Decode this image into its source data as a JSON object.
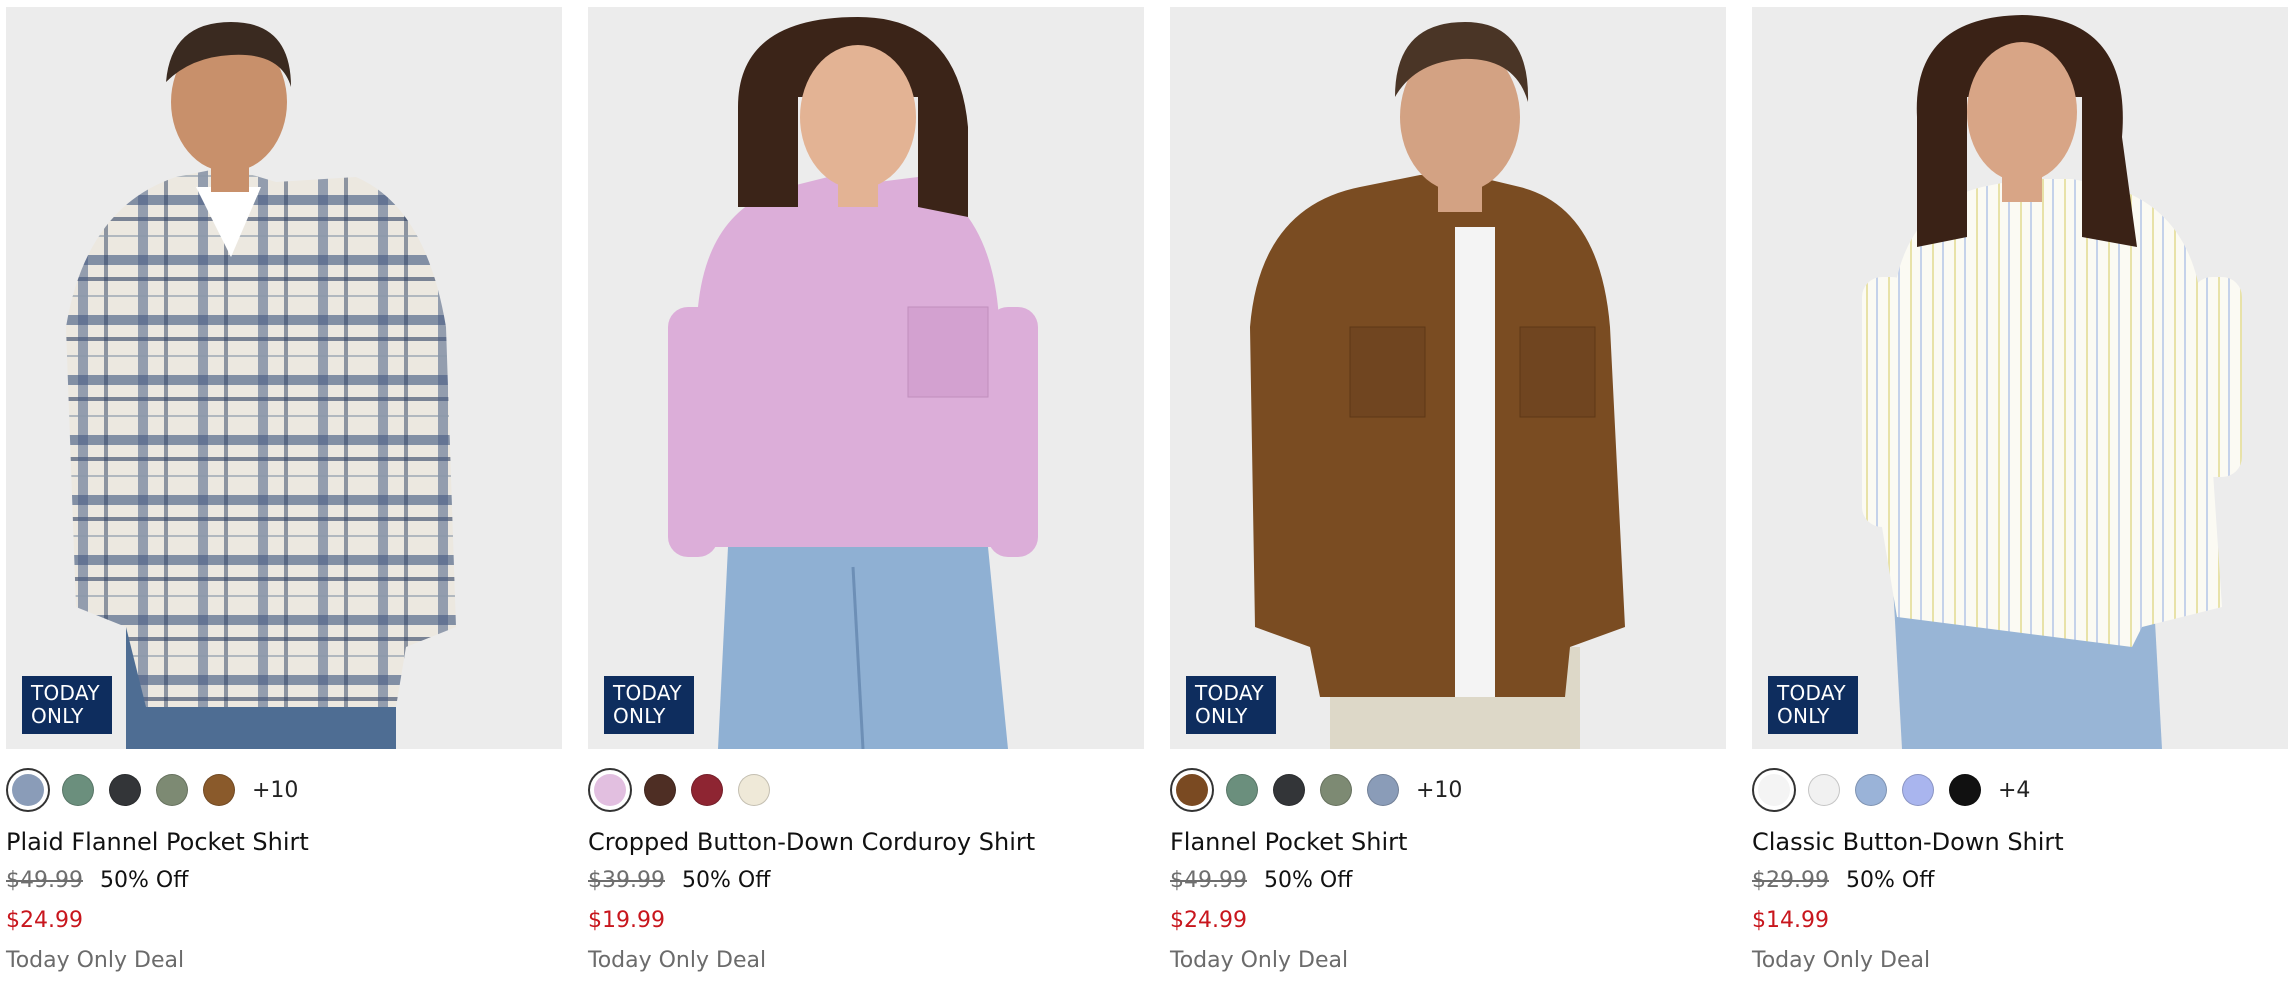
{
  "products": [
    {
      "name": "Plaid Flannel Pocket Shirt",
      "badge": [
        "TODAY",
        "ONLY"
      ],
      "original_price": "$49.99",
      "discount": "50% Off",
      "sale_price": "$24.99",
      "deal_label": "Today Only Deal",
      "more_colors": "+10",
      "swatches": [
        {
          "name": "blue plaid",
          "color": "#8a9cb8",
          "selected": true
        },
        {
          "name": "green",
          "color": "#6b8f7d",
          "selected": false
        },
        {
          "name": "charcoal",
          "color": "#333538",
          "selected": false
        },
        {
          "name": "green plaid",
          "color": "#7d8a73",
          "selected": false
        },
        {
          "name": "brown",
          "color": "#8a5a2b",
          "selected": false
        }
      ]
    },
    {
      "name": "Cropped Button-Down Corduroy Shirt",
      "badge": [
        "TODAY",
        "ONLY"
      ],
      "original_price": "$39.99",
      "discount": "50% Off",
      "sale_price": "$19.99",
      "deal_label": "Today Only Deal",
      "more_colors": "",
      "swatches": [
        {
          "name": "lilac",
          "color": "#e2bfe0",
          "selected": true
        },
        {
          "name": "dark brown",
          "color": "#4e2e24",
          "selected": false
        },
        {
          "name": "burgundy",
          "color": "#8e2532",
          "selected": false
        },
        {
          "name": "cream",
          "color": "#efe9d8",
          "selected": false
        }
      ]
    },
    {
      "name": "Flannel Pocket Shirt",
      "badge": [
        "TODAY",
        "ONLY"
      ],
      "original_price": "$49.99",
      "discount": "50% Off",
      "sale_price": "$24.99",
      "deal_label": "Today Only Deal",
      "more_colors": "+10",
      "swatches": [
        {
          "name": "brown",
          "color": "#7a4a22",
          "selected": true
        },
        {
          "name": "green",
          "color": "#6b8f7d",
          "selected": false
        },
        {
          "name": "charcoal",
          "color": "#333538",
          "selected": false
        },
        {
          "name": "green plaid",
          "color": "#7d8a73",
          "selected": false
        },
        {
          "name": "blue plaid",
          "color": "#8a9cb8",
          "selected": false
        }
      ]
    },
    {
      "name": "Classic Button-Down Shirt",
      "badge": [
        "TODAY",
        "ONLY"
      ],
      "original_price": "$29.99",
      "discount": "50% Off",
      "sale_price": "$14.99",
      "deal_label": "Today Only Deal",
      "more_colors": "+4",
      "swatches": [
        {
          "name": "white",
          "color": "#f4f4f4",
          "selected": true
        },
        {
          "name": "light gray",
          "color": "#f1f1f1",
          "selected": false
        },
        {
          "name": "light blue",
          "color": "#9ab3d8",
          "selected": false
        },
        {
          "name": "blue stripe",
          "color": "#a9b5ee",
          "selected": false
        },
        {
          "name": "black",
          "color": "#111111",
          "selected": false
        }
      ]
    }
  ],
  "colors": {
    "badge_bg": "#0e2d5e",
    "sale_red": "#c8161d",
    "strike_gray": "#6e6e6e",
    "deal_gray": "#6b6b6b",
    "photo_bg": "#ececec"
  }
}
